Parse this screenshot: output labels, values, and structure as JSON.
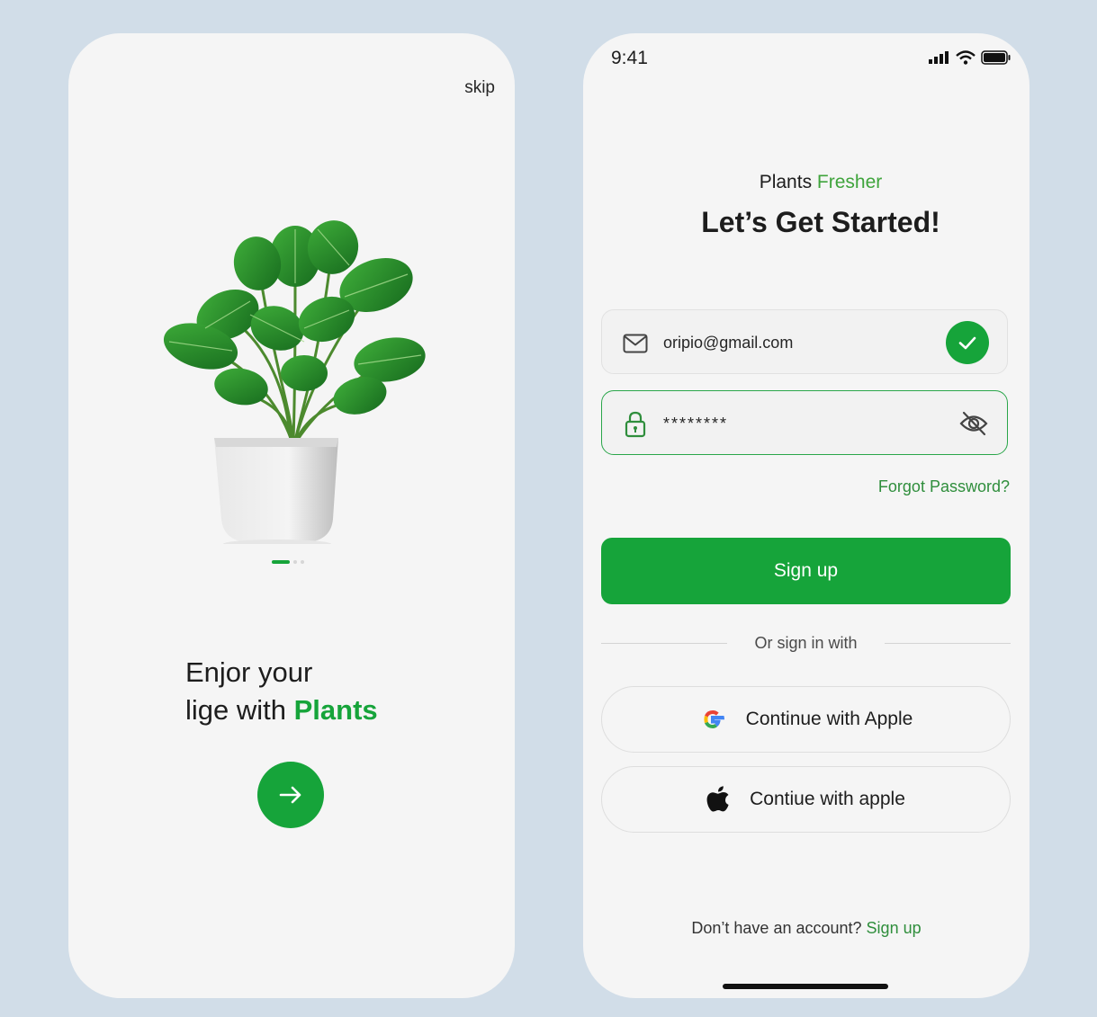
{
  "onboarding": {
    "skip_label": "skip",
    "headline_line1": "Enjor your",
    "headline_line2_prefix": "lige with",
    "headline_line2_accent": "Plants",
    "pagination": {
      "current": 1,
      "total": 3
    },
    "next_icon": "arrow-right-icon",
    "image": "potted-monstera-plant"
  },
  "login": {
    "status_bar": {
      "time": "9:41",
      "icons": [
        "cellular-signal-icon",
        "wifi-icon",
        "battery-icon"
      ]
    },
    "brand_prefix": "Plants",
    "brand_accent": "Fresher",
    "title": "Let’s Get Started!",
    "email": {
      "value": "oripio@gmail.com",
      "icon": "mail-icon",
      "valid_icon": "check-circle-icon"
    },
    "password": {
      "value": "********",
      "icon": "lock-icon",
      "toggle_icon": "eye-off-icon"
    },
    "forgot_password_label": "Forgot Password?",
    "signup_button_label": "Sign up",
    "divider_text": "Or sign in with",
    "social_buttons": [
      {
        "label": "Continue with Apple",
        "icon": "google-icon"
      },
      {
        "label": "Contiue with apple",
        "icon": "apple-icon"
      }
    ],
    "bottom_prompt": "Don’t have an account?",
    "bottom_link": "Sign up"
  },
  "colors": {
    "brand_green": "#16a43a",
    "link_green": "#2f8e3c",
    "background": "#d1dde8",
    "screen": "#f5f5f5"
  }
}
